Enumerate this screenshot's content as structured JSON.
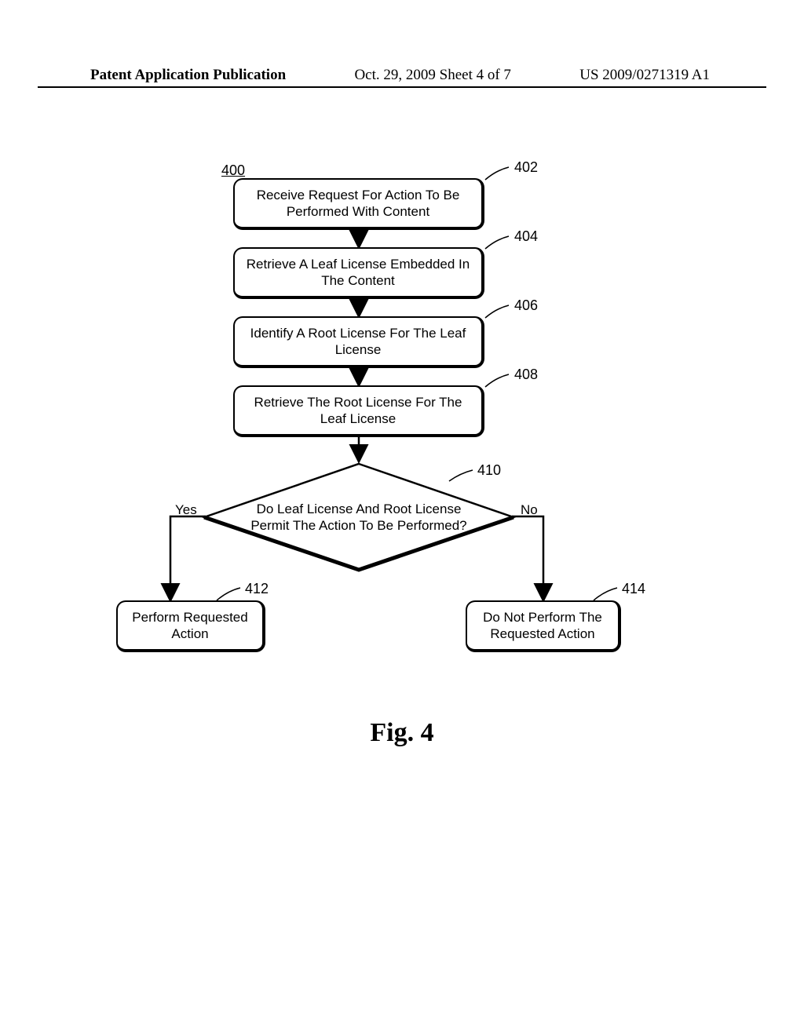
{
  "header": {
    "left": "Patent Application Publication",
    "center": "Oct. 29, 2009  Sheet 4 of 7",
    "right": "US 2009/0271319 A1"
  },
  "figure_number": "400",
  "boxes": {
    "b402": "Receive Request For Action To Be Performed With Content",
    "b404": "Retrieve A Leaf License Embedded In The Content",
    "b406": "Identify A Root License For The Leaf License",
    "b408": "Retrieve The Root License For The Leaf License",
    "b412": "Perform Requested Action",
    "b414": "Do Not Perform The Requested Action"
  },
  "decision": {
    "b410": "Do Leaf License And Root License Permit The Action To Be Performed?"
  },
  "refs": {
    "r402": "402",
    "r404": "404",
    "r406": "406",
    "r408": "408",
    "r410": "410",
    "r412": "412",
    "r414": "414"
  },
  "branches": {
    "yes": "Yes",
    "no": "No"
  },
  "caption": "Fig. 4"
}
